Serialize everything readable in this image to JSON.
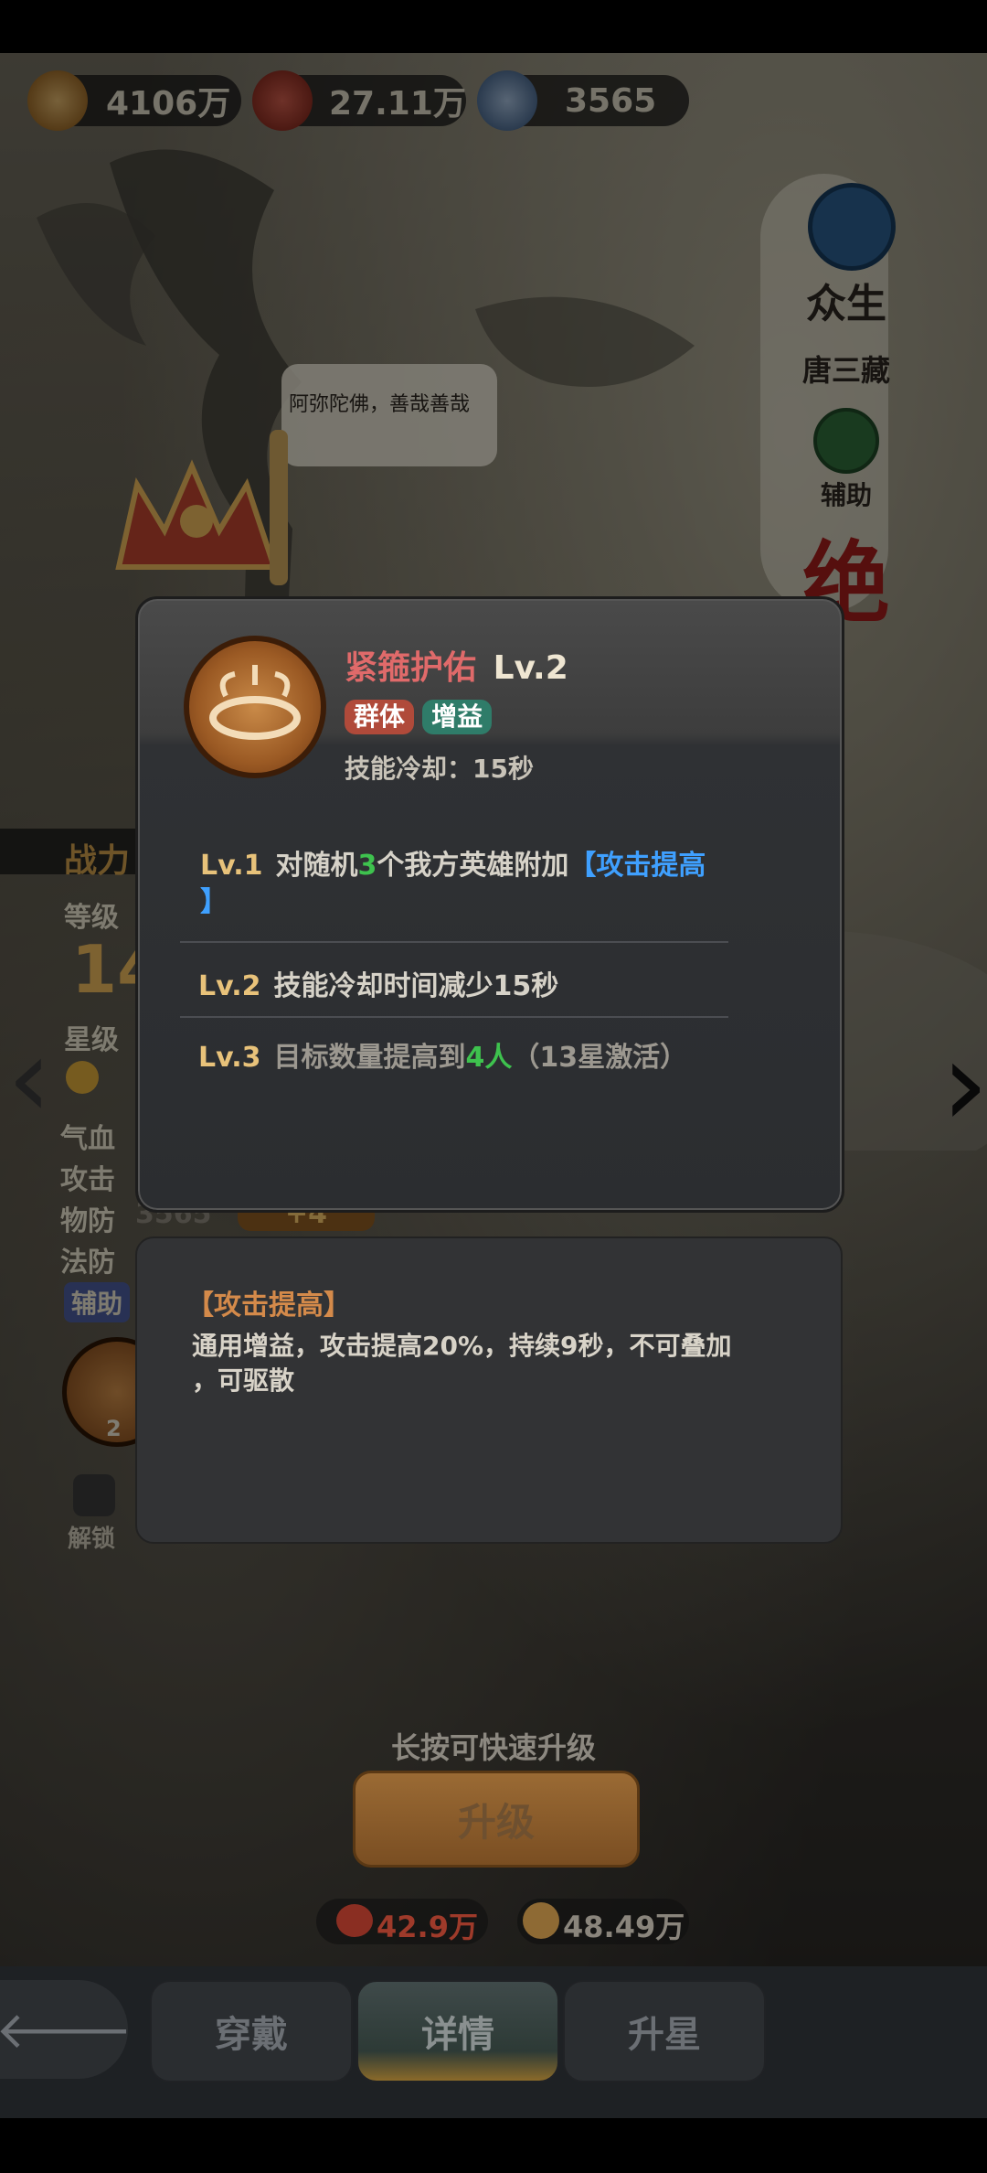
{
  "resources": [
    {
      "name": "coins",
      "value": "4106万"
    },
    {
      "name": "meat",
      "value": "27.11万"
    },
    {
      "name": "gourd",
      "value": "3565"
    }
  ],
  "hero": {
    "faction": "众生",
    "name": "唐三藏",
    "role": "辅助",
    "rarity": "绝",
    "speech": "阿弥陀佛，善哉善哉"
  },
  "stats": {
    "power_label": "战力",
    "level_label": "等级",
    "level_value": "14",
    "star_label": "星级",
    "hp_label": "气血",
    "atk_label": "攻击",
    "pdef_label": "物防",
    "pdef_value": "3565",
    "pdef_bonus": "+4",
    "mdef_label": "法防",
    "role_badge": "辅助",
    "skill_level": "2",
    "unlock_label": "解锁"
  },
  "skill": {
    "name": "紧箍护佑",
    "level": "Lv.2",
    "tags": [
      "群体",
      "增益"
    ],
    "cooldown": "技能冷却：15秒",
    "levels": [
      {
        "label": "Lv.1",
        "pre": "对随机",
        "hl": "3",
        "mid": "个我方英雄附加",
        "buff": "【攻击提高",
        "wrap": "】"
      },
      {
        "label": "Lv.2",
        "text": "技能冷却时间减少15秒"
      },
      {
        "label": "Lv.3",
        "pre": "目标数量提高到",
        "hl": "4人",
        "post": "（13星激活）"
      }
    ]
  },
  "buff_info": {
    "title": "【攻击提高】",
    "desc_line1": "通用增益，攻击提高20%，持续9秒，不可叠加",
    "desc_line2": "，可驱散"
  },
  "upgrade": {
    "hint": "长按可快速升级",
    "button": "升级",
    "cost_meat": "42.9万",
    "cost_coins": "48.49万"
  },
  "nav": {
    "wear": "穿戴",
    "detail": "详情",
    "star_up": "升星"
  },
  "colors": {
    "skill_name": "#e06a6a",
    "buff_blue": "#3fa0ff",
    "highlight_green": "#3ec24e",
    "tag_group": "#b04a3a",
    "tag_buff": "#2f7c69",
    "cost_red": "#c0392b"
  }
}
